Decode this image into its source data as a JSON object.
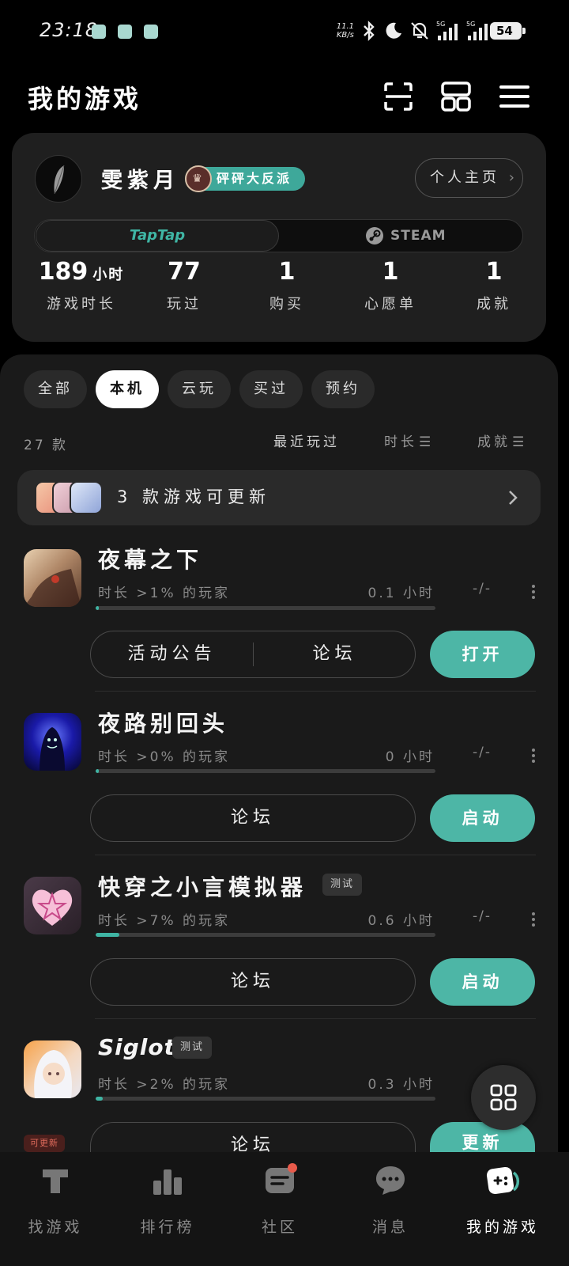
{
  "status": {
    "time": "23:18",
    "net_speed_value": "11.1",
    "net_speed_unit": "KB/s",
    "battery": "54"
  },
  "header": {
    "title": "我的游戏",
    "icons": [
      "scan-icon",
      "grid-view-icon",
      "menu-icon"
    ]
  },
  "profile": {
    "name": "雯紫月",
    "badge": "砰砰大反派",
    "homepage": "个人主页",
    "platforms": {
      "taptap": "TapTap",
      "steam": "STEAM",
      "active": "TapTap"
    },
    "stats": [
      {
        "value": "189",
        "unit": "小时",
        "label": "游戏时长"
      },
      {
        "value": "77",
        "unit": "",
        "label": "玩过"
      },
      {
        "value": "1",
        "unit": "",
        "label": "购买"
      },
      {
        "value": "1",
        "unit": "",
        "label": "心愿单"
      },
      {
        "value": "1",
        "unit": "",
        "label": "成就"
      }
    ]
  },
  "filters": {
    "chips": [
      "全部",
      "本机",
      "云玩",
      "买过",
      "预约"
    ],
    "active": "本机",
    "count": "27 款",
    "sort": [
      "最近玩过",
      "时长",
      "成就"
    ]
  },
  "update_bar": {
    "text": "3 款游戏可更新"
  },
  "games": [
    {
      "name": "夜幕之下",
      "tag": "",
      "players": "时长 >1% 的玩家",
      "hours": "0.1 小时",
      "achievement": "-/-",
      "progress": 0.01,
      "buttons": [
        "活动公告",
        "论坛"
      ],
      "primary": "打开"
    },
    {
      "name": "夜路别回头",
      "tag": "",
      "players": "时长 >0% 的玩家",
      "hours": "0 小时",
      "achievement": "-/-",
      "progress": 0.01,
      "buttons": [
        "论坛"
      ],
      "primary": "启动"
    },
    {
      "name": "快穿之小言模拟器",
      "tag": "测试",
      "players": "时长 >7% 的玩家",
      "hours": "0.6 小时",
      "achievement": "-/-",
      "progress": 0.07,
      "buttons": [
        "论坛"
      ],
      "primary": "启动"
    },
    {
      "name": "Siglota",
      "tag": "测试",
      "players": "时长 >2% 的玩家",
      "hours": "0.3 小时",
      "achievement": "",
      "progress": 0.02,
      "buttons": [
        "论坛"
      ],
      "primary": "更新",
      "badge": "可更新"
    }
  ],
  "bottom_nav": [
    {
      "label": "找游戏",
      "icon": "taptap-logo-icon"
    },
    {
      "label": "排行榜",
      "icon": "ranking-icon"
    },
    {
      "label": "社区",
      "icon": "community-icon"
    },
    {
      "label": "消息",
      "icon": "message-icon"
    },
    {
      "label": "我的游戏",
      "icon": "gamepad-icon",
      "active": true
    }
  ],
  "colors": {
    "accent": "#4db6a6",
    "background": "#000000",
    "panel": "#1a1a1a"
  }
}
